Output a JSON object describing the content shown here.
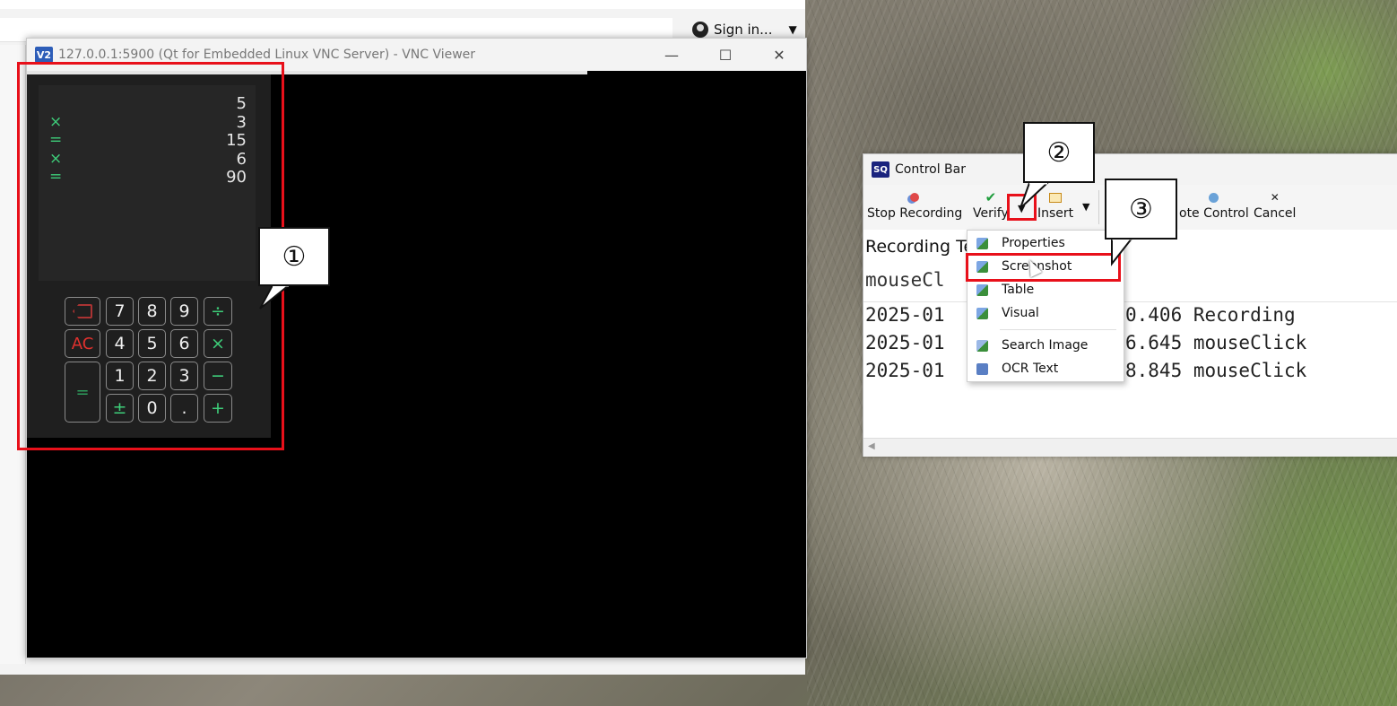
{
  "browser": {
    "signin_label": "Sign in..."
  },
  "vnc": {
    "title": "127.0.0.1:5900 (Qt for Embedded Linux VNC Server) - VNC Viewer",
    "logo": "V2"
  },
  "calculator": {
    "tape": [
      {
        "op": "",
        "value": "5"
      },
      {
        "op": "×",
        "value": "3"
      },
      {
        "op": "=",
        "value": "15"
      },
      {
        "op": "×",
        "value": "6"
      },
      {
        "op": "=",
        "value": "90"
      }
    ],
    "keys": {
      "backspace_icon": "backspace-icon",
      "seven": "7",
      "eight": "8",
      "nine": "9",
      "divide": "÷",
      "ac": "AC",
      "four": "4",
      "five": "5",
      "six": "6",
      "multiply": "×",
      "one": "1",
      "two": "2",
      "three": "3",
      "minus": "−",
      "equals": "=",
      "plusminus": "±",
      "zero": "0",
      "dot": ".",
      "plus": "+"
    }
  },
  "callouts": {
    "one": "①",
    "two": "②",
    "three": "③"
  },
  "control_bar": {
    "logo": "SQ",
    "title": "Control Bar",
    "toolbar": {
      "stop_recording": "Stop Recording",
      "verify": "Verify",
      "insert": "Insert",
      "remote_control": "ote Control",
      "cancel": "Cancel"
    },
    "heading": "Recording Te",
    "mono_line": "mouseCl",
    "log": [
      {
        "left": "2025-01",
        "right": "0.406 Recording"
      },
      {
        "left": "2025-01",
        "right": "6.645 mouseClick"
      },
      {
        "left": "2025-01",
        "right": "8.845 mouseClick"
      }
    ]
  },
  "verify_menu": {
    "items": [
      {
        "label": "Properties",
        "icon": "properties-icon"
      },
      {
        "label": "Screenshot",
        "icon": "screenshot-icon"
      },
      {
        "label": "Table",
        "icon": "table-icon"
      },
      {
        "label": "Visual",
        "icon": "visual-icon"
      },
      {
        "label": "Search Image",
        "icon": "search-image-icon"
      },
      {
        "label": "OCR Text",
        "icon": "ocr-text-icon"
      }
    ]
  },
  "colors": {
    "annotation_red": "#e8101a",
    "calc_accent_green": "#3ecf7a",
    "calc_ac_red": "#e0312e"
  }
}
